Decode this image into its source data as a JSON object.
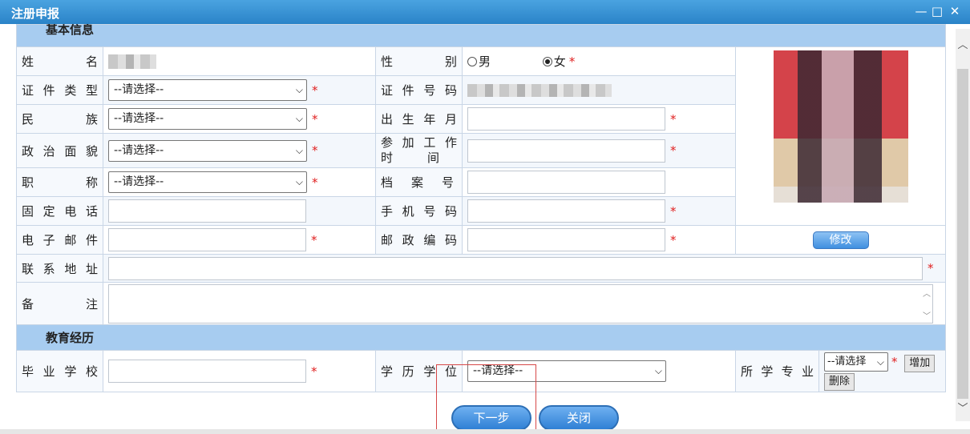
{
  "window": {
    "title": "注册申报"
  },
  "sections": {
    "basic": "基本信息",
    "education": "教育经历"
  },
  "fields": {
    "name": "姓名",
    "gender": "性别",
    "gender_options": [
      "男",
      "女"
    ],
    "gender_selected": "女",
    "id_type": "证件类型",
    "id_number": "证件号码",
    "ethnicity": "民族",
    "birth": "出生年月",
    "political": "政治面貌",
    "work_start_line1": "参加工作",
    "work_start_line2": "时间",
    "title": "职称",
    "archive": "档案号",
    "phone": "固定电话",
    "mobile": "手机号码",
    "email": "电子邮件",
    "postcode": "邮政编码",
    "address": "联系地址",
    "remark": "备注",
    "school": "毕业学校",
    "degree": "学历学位",
    "major": "所学专业"
  },
  "select_placeholder": "--请选择--",
  "select_placeholder_short": "--请选择",
  "required_mark": "*",
  "buttons": {
    "modify": "修改",
    "add": "增加",
    "delete": "删除",
    "next": "下一步",
    "close": "关闭"
  },
  "window_controls": {
    "minimize": "—",
    "maximize": "□",
    "close": "✕"
  }
}
